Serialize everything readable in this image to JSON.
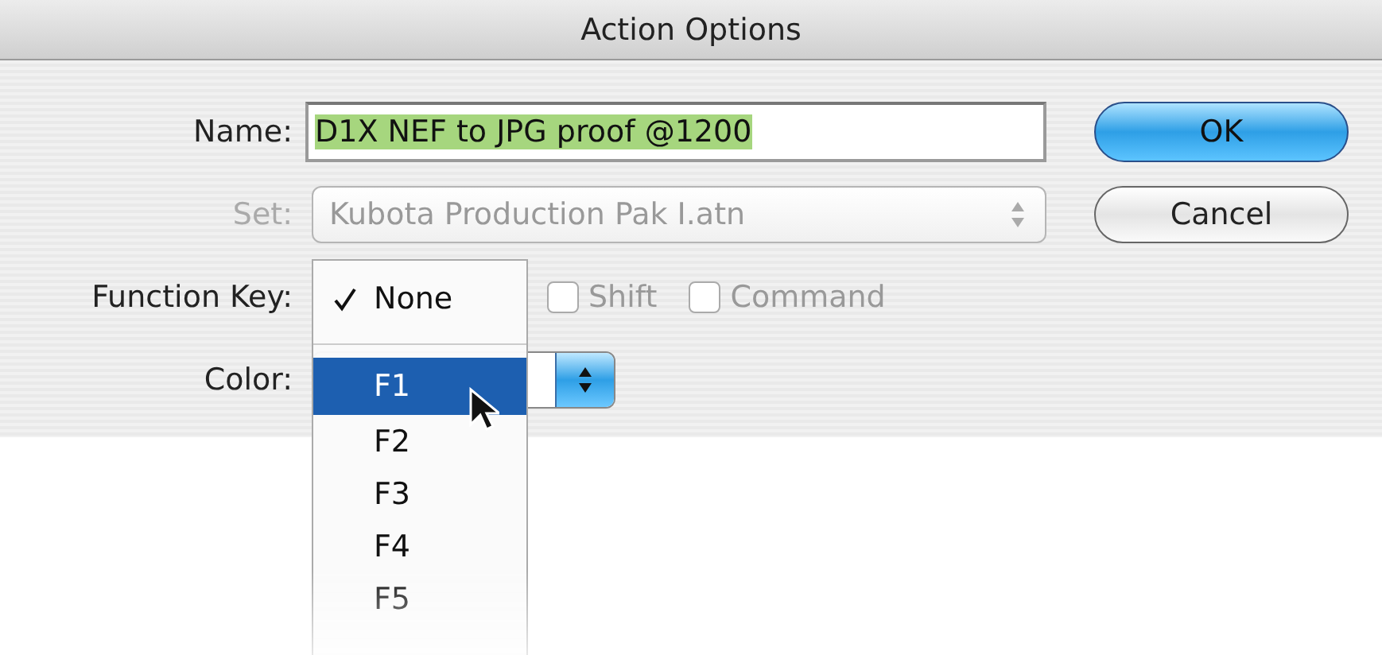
{
  "window": {
    "title": "Action Options"
  },
  "name": {
    "label": "Name:",
    "value": "D1X NEF to JPG proof @1200",
    "value_selected": true
  },
  "set": {
    "label": "Set:",
    "value": "Kubota Production Pak I.atn",
    "disabled": true
  },
  "function_key": {
    "label": "Function Key:",
    "menu": [
      {
        "label": "None",
        "checked": true,
        "selected": false,
        "kind": "item"
      },
      {
        "kind": "separator"
      },
      {
        "label": "F1",
        "checked": false,
        "selected": true,
        "kind": "item"
      },
      {
        "label": "F2",
        "checked": false,
        "selected": false,
        "kind": "item"
      },
      {
        "label": "F3",
        "checked": false,
        "selected": false,
        "kind": "item"
      },
      {
        "label": "F4",
        "checked": false,
        "selected": false,
        "kind": "item"
      },
      {
        "label": "F5",
        "checked": false,
        "selected": false,
        "kind": "item"
      }
    ],
    "checkboxes": [
      {
        "label": "Shift",
        "checked": false,
        "disabled": true
      },
      {
        "label": "Command",
        "checked": false,
        "disabled": true
      }
    ]
  },
  "color": {
    "label": "Color:"
  },
  "buttons": [
    {
      "label": "OK",
      "default": true
    },
    {
      "label": "Cancel",
      "default": false
    }
  ]
}
